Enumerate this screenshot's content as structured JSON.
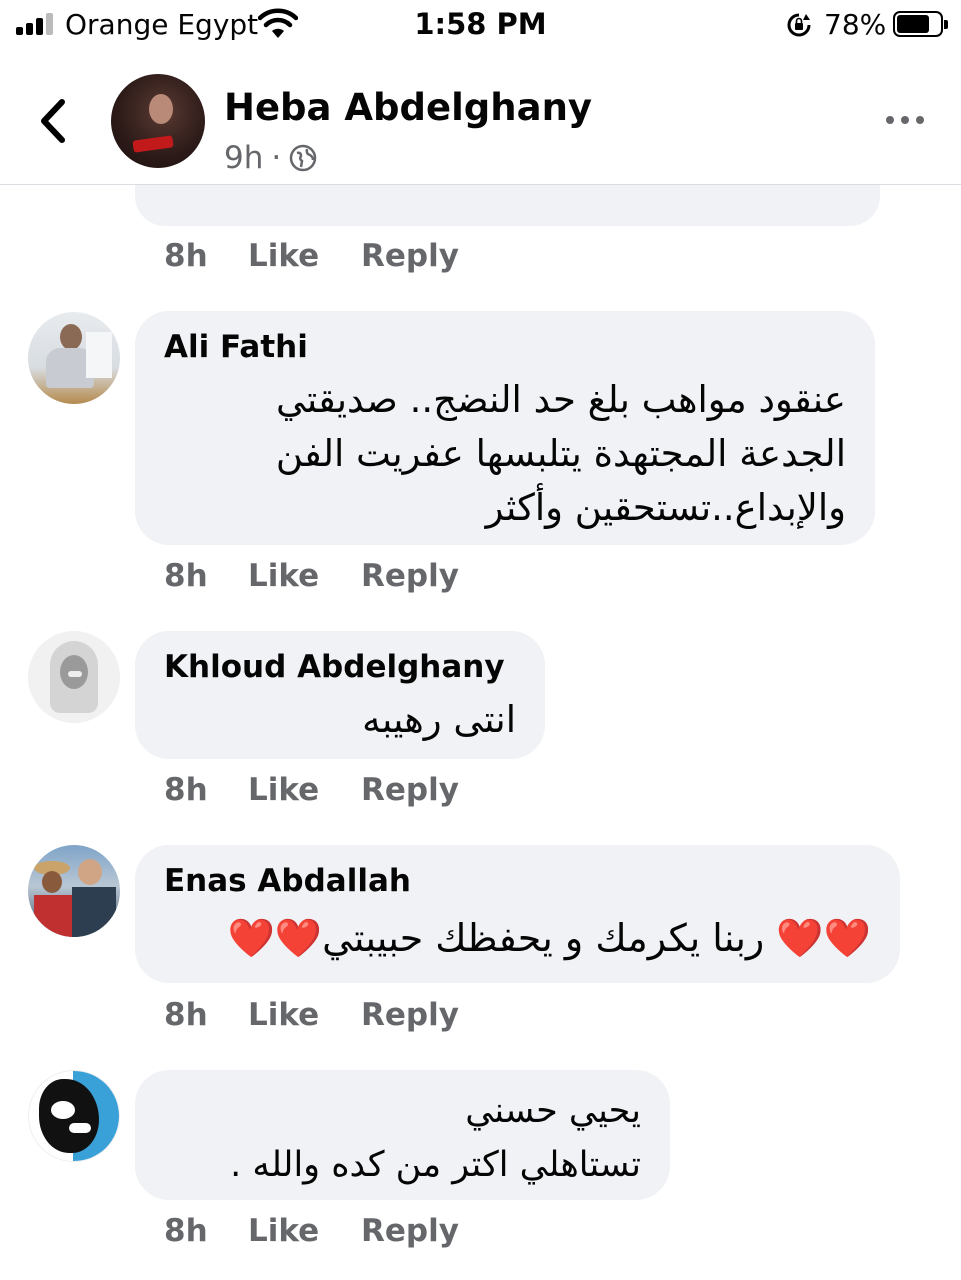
{
  "status_bar": {
    "carrier": "Orange Egypt",
    "time": "1:58 PM",
    "battery_percent": "78%",
    "battery_level": 0.78,
    "icons": [
      "signal-icon",
      "wifi-icon",
      "orientation-lock-icon",
      "battery-icon"
    ]
  },
  "post_header": {
    "author": "Heba Abdelghany",
    "time": "9h",
    "separator": "·",
    "audience_icon": "globe-icon",
    "back_icon": "chevron-left-icon",
    "more_icon": "more-dots-icon"
  },
  "previous_comment_actions": {
    "time": "8h",
    "like": "Like",
    "reply": "Reply"
  },
  "comments": [
    {
      "author": "Ali Fathi",
      "text": "عنقود مواهب بلغ حد النضج.. صديقتي\nالجدعة  المجتهدة يتلبسها عفريت الفن\nوالإبداع..تستحقين وأكثر",
      "time": "8h",
      "like": "Like",
      "reply": "Reply"
    },
    {
      "author": "Khloud Abdelghany",
      "text": "انتى رهيبه",
      "time": "8h",
      "like": "Like",
      "reply": "Reply"
    },
    {
      "author": "Enas Abdallah",
      "text": "❤️❤️ ربنا يكرمك و يحفظك حبيبتي❤️❤️",
      "time": "8h",
      "like": "Like",
      "reply": "Reply"
    },
    {
      "author": "",
      "text": "يحيي  حسني\nتستاهلي اكتر من كده والله .",
      "time": "8h",
      "like": "Like",
      "reply": "Reply"
    }
  ],
  "colors": {
    "bubble_background": "#f0f2f5",
    "secondary_text": "#65676b",
    "primary_text": "#050505"
  }
}
